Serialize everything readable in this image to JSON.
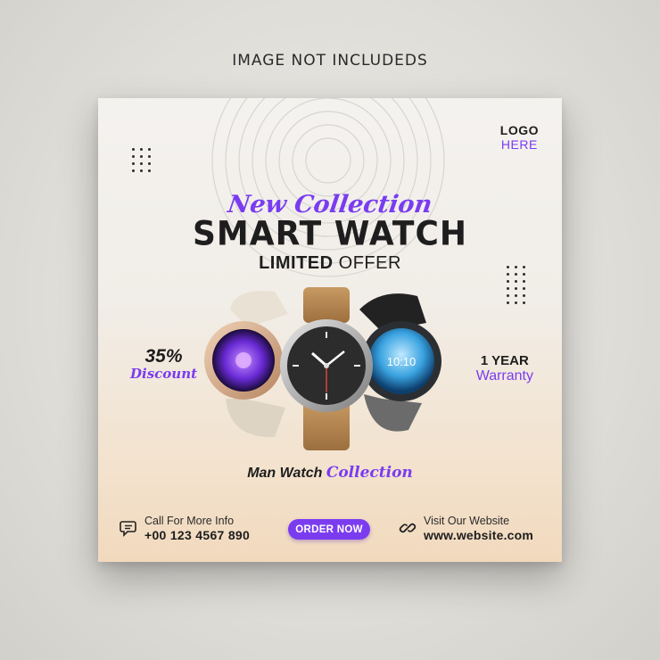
{
  "top_note": "IMAGE NOT INCLUDEDS",
  "logo": {
    "line1": "LOGO",
    "line2": "HERE"
  },
  "headline": {
    "script": "New Collection",
    "main": "SMART WATCH",
    "sub_bold": "LIMITED",
    "sub_rest": " OFFER"
  },
  "discount": {
    "percent": "35%",
    "label": "Discount"
  },
  "warranty": {
    "years": "1 YEAR",
    "label": "Warranty"
  },
  "watches": [
    {
      "name": "rose-gold-watch",
      "strap": "beige",
      "face": "purple-flower"
    },
    {
      "name": "silver-analog-watch",
      "strap": "tan-leather",
      "face": "dark-analog"
    },
    {
      "name": "black-digital-watch",
      "strap": "black",
      "face": "blue-digital",
      "time": "10:10"
    }
  ],
  "collection": {
    "main": "Man Watch",
    "script": "Collection"
  },
  "contact": {
    "label": "Call For More Info",
    "phone": "+00 123 4567 890"
  },
  "order_button": "ORDER NOW",
  "website": {
    "label": "Visit Our Website",
    "url": "www.website.com"
  },
  "colors": {
    "accent": "#7b3cf0",
    "text": "#1d1d1d",
    "card_top": "#f4f2ef",
    "card_bottom": "#f1d9bd"
  }
}
